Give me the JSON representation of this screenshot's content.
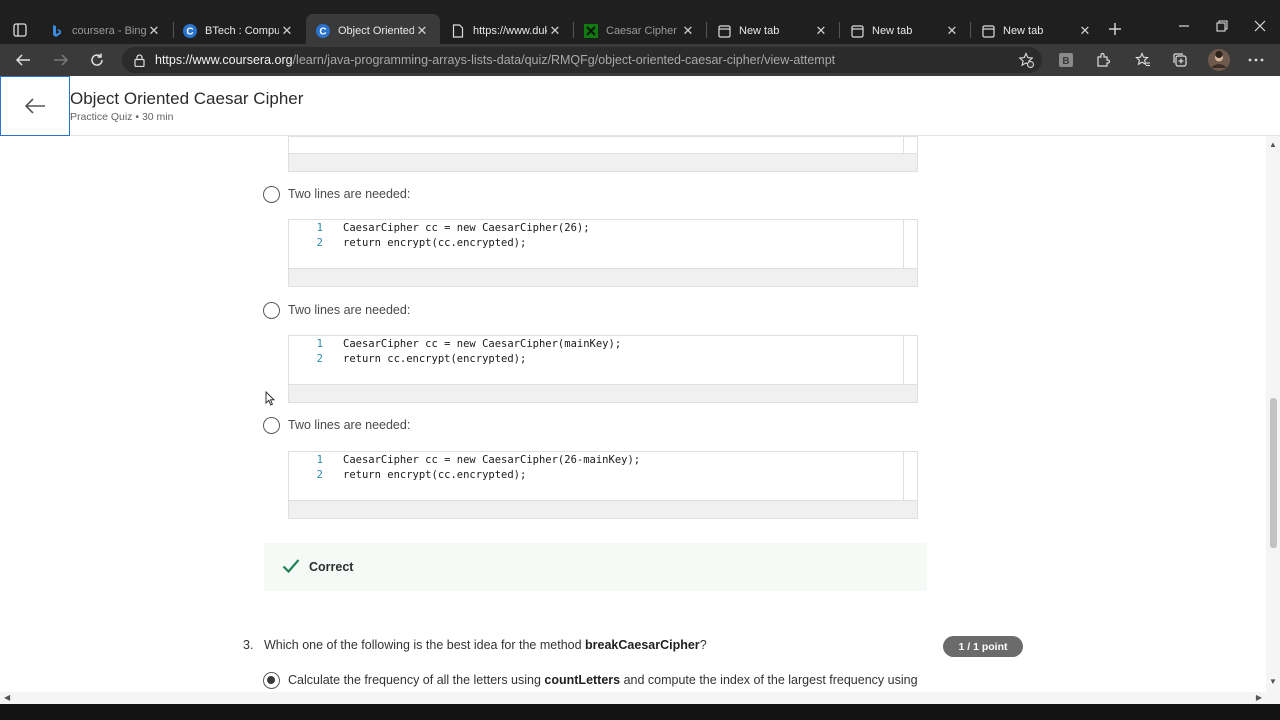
{
  "browser": {
    "tabs": [
      {
        "title": "coursera - Bing",
        "favicon": "bing-icon"
      },
      {
        "title": "BTech : Computer",
        "favicon": "coursera-icon"
      },
      {
        "title": "Object Oriented C",
        "favicon": "coursera-icon",
        "active": true
      },
      {
        "title": "https://www.duke",
        "favicon": "page-icon"
      },
      {
        "title": "Caesar Cipher De",
        "favicon": "xbox-icon"
      },
      {
        "title": "New tab",
        "favicon": "newtab-icon"
      },
      {
        "title": "New tab",
        "favicon": "newtab-icon"
      },
      {
        "title": "New tab",
        "favicon": "newtab-icon"
      }
    ],
    "url_host": "https://www.coursera.org",
    "url_path": "/learn/java-programming-arrays-lists-data/quiz/RMQFg/object-oriented-caesar-cipher/view-attempt"
  },
  "header": {
    "title": "Object Oriented Caesar Cipher",
    "subtitle": "Practice Quiz • 30 min"
  },
  "options": [
    {
      "label": "Two lines are needed:",
      "lines": [
        {
          "n": "1",
          "code": "CaesarCipher cc = new CaesarCipher(26);"
        },
        {
          "n": "2",
          "code": "return encrypt(cc.encrypted);"
        }
      ]
    },
    {
      "label": "Two lines are needed:",
      "lines": [
        {
          "n": "1",
          "code": "CaesarCipher cc = new CaesarCipher(mainKey);"
        },
        {
          "n": "2",
          "code": "return cc.encrypt(encrypted);"
        }
      ]
    },
    {
      "label": "Two lines are needed:",
      "lines": [
        {
          "n": "1",
          "code": "CaesarCipher cc = new CaesarCipher(26-mainKey);"
        },
        {
          "n": "2",
          "code": "return encrypt(cc.encrypted);"
        }
      ]
    }
  ],
  "feedback": {
    "label": "Correct"
  },
  "question3": {
    "number": "3.",
    "text_before": "Which one of the following is the best idea for the method ",
    "text_bold": "breakCaesarCipher",
    "text_after": "?",
    "points": "1 / 1 point",
    "answer_before": "Calculate the frequency of all the letters using ",
    "answer_bold": "countLetters",
    "answer_after": " and compute the index of the largest frequency using"
  },
  "colors": {
    "accent": "#2a73cc",
    "correct_check": "#1f8354",
    "badge": "#6b6b6b"
  }
}
